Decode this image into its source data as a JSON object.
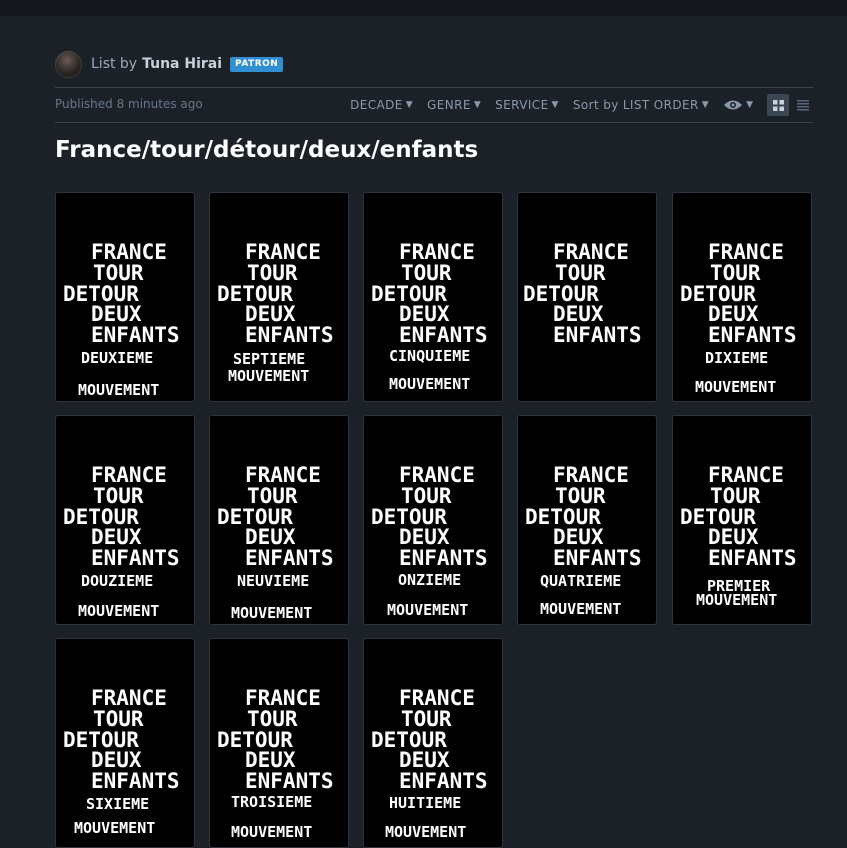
{
  "byline": {
    "prefix": "List by",
    "name": "Tuna Hirai",
    "badge": "PATRON"
  },
  "published": "Published 8 minutes ago",
  "filters": {
    "decade": "DECADE",
    "genre": "GENRE",
    "service": "SERVICE",
    "sort_prefix": "Sort by",
    "sort_value": "LIST ORDER"
  },
  "list_title": "France/tour/détour/deux/enfants",
  "poster_title": {
    "l1": "FRANCE",
    "l2": "TOUR",
    "l3": "DETOUR",
    "l4": "DEUX",
    "l5": "ENFANTS"
  },
  "posters": [
    {
      "subtitle": "DEUXIEME",
      "bottom": "MOUVEMENT"
    },
    {
      "subtitle": "SEPTIEME",
      "bottom": "MOUVEMENT"
    },
    {
      "subtitle": "CINQUIEME",
      "bottom": "MOUVEMENT"
    },
    {
      "subtitle": "",
      "bottom": ""
    },
    {
      "subtitle": "DIXIEME",
      "bottom": "MOUVEMENT"
    },
    {
      "subtitle": "DOUZIEME",
      "bottom": "MOUVEMENT"
    },
    {
      "subtitle": "NEUVIEME",
      "bottom": "MOUVEMENT"
    },
    {
      "subtitle": "ONZIEME",
      "bottom": "MOUVEMENT"
    },
    {
      "subtitle": "QUATRIEME",
      "bottom": "MOUVEMENT"
    },
    {
      "subtitle": "PREMIER",
      "bottom": "MOUVEMENT"
    },
    {
      "subtitle": "SIXIEME",
      "bottom": "MOUVEMENT"
    },
    {
      "subtitle": "TROISIEME",
      "bottom": "MOUVEMENT"
    },
    {
      "subtitle": "HUITIEME",
      "bottom": "MOUVEMENT"
    }
  ]
}
